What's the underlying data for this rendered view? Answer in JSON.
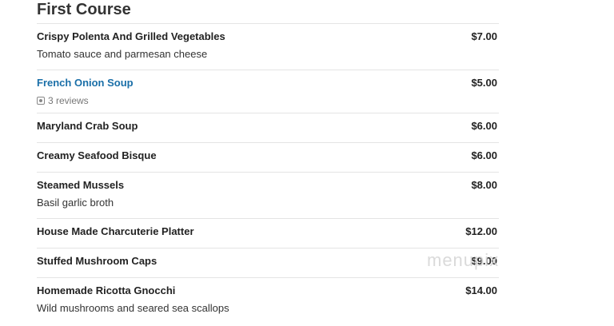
{
  "section": {
    "title": "First Course"
  },
  "items": [
    {
      "name": "Crispy Polenta And Grilled Vegetables",
      "price": "$7.00",
      "description": "Tomato sauce and parmesan cheese"
    },
    {
      "name": "French Onion Soup",
      "price": "$5.00",
      "reviews": "3 reviews"
    },
    {
      "name": "Maryland Crab Soup",
      "price": "$6.00"
    },
    {
      "name": "Creamy Seafood Bisque",
      "price": "$6.00"
    },
    {
      "name": "Steamed Mussels",
      "price": "$8.00",
      "description": "Basil garlic broth"
    },
    {
      "name": "House Made Charcuterie Platter",
      "price": "$12.00"
    },
    {
      "name": "Stuffed Mushroom Caps",
      "price": "$9.00"
    },
    {
      "name": "Homemade Ricotta Gnocchi",
      "price": "$14.00",
      "description": "Wild mushrooms and seared sea scallops"
    }
  ],
  "watermark": "menupix",
  "colors": {
    "link": "#1a6fa8",
    "divider": "#e4e4e4",
    "text": "#222222"
  }
}
